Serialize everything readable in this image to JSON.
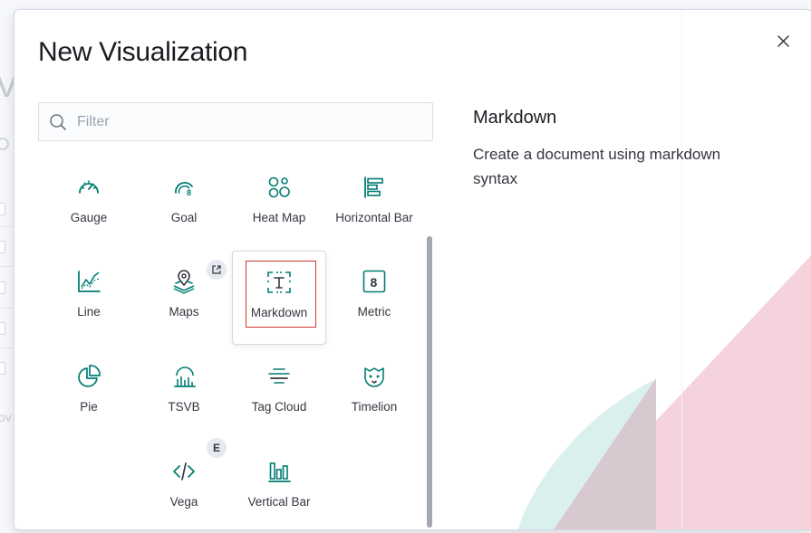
{
  "modal": {
    "title": "New Visualization",
    "close_icon": "close-icon"
  },
  "filter": {
    "placeholder": "Filter",
    "value": ""
  },
  "visualizations": [
    {
      "id": "gauge",
      "label": "Gauge",
      "icon": "gauge-icon"
    },
    {
      "id": "goal",
      "label": "Goal",
      "icon": "goal-icon"
    },
    {
      "id": "heat-map",
      "label": "Heat Map",
      "icon": "heatmap-icon"
    },
    {
      "id": "horizontal-bar",
      "label": "Horizontal Bar",
      "icon": "horizontal-bar-icon"
    },
    {
      "id": "line",
      "label": "Line",
      "icon": "line-chart-icon"
    },
    {
      "id": "maps",
      "label": "Maps",
      "icon": "maps-icon",
      "badge_icon": "external-link-icon"
    },
    {
      "id": "markdown",
      "label": "Markdown",
      "icon": "markdown-icon",
      "selected": true
    },
    {
      "id": "metric",
      "label": "Metric",
      "icon": "metric-icon"
    },
    {
      "id": "pie",
      "label": "Pie",
      "icon": "pie-chart-icon"
    },
    {
      "id": "tsvb",
      "label": "TSVB",
      "icon": "tsvb-icon"
    },
    {
      "id": "tag-cloud",
      "label": "Tag Cloud",
      "icon": "tag-cloud-icon"
    },
    {
      "id": "timelion",
      "label": "Timelion",
      "icon": "timelion-icon"
    },
    {
      "id": "vega",
      "label": "Vega",
      "icon": "vega-icon",
      "badge_text": "E"
    },
    {
      "id": "vertical-bar",
      "label": "Vertical Bar",
      "icon": "vertical-bar-icon"
    }
  ],
  "description": {
    "title": "Markdown",
    "text": "Create a document using markdown syntax"
  },
  "colors": {
    "icon": "#017d73",
    "selection_outline": "#c8382f",
    "deco_pink": "#f2ccd6",
    "deco_teal": "#d6efec"
  }
}
